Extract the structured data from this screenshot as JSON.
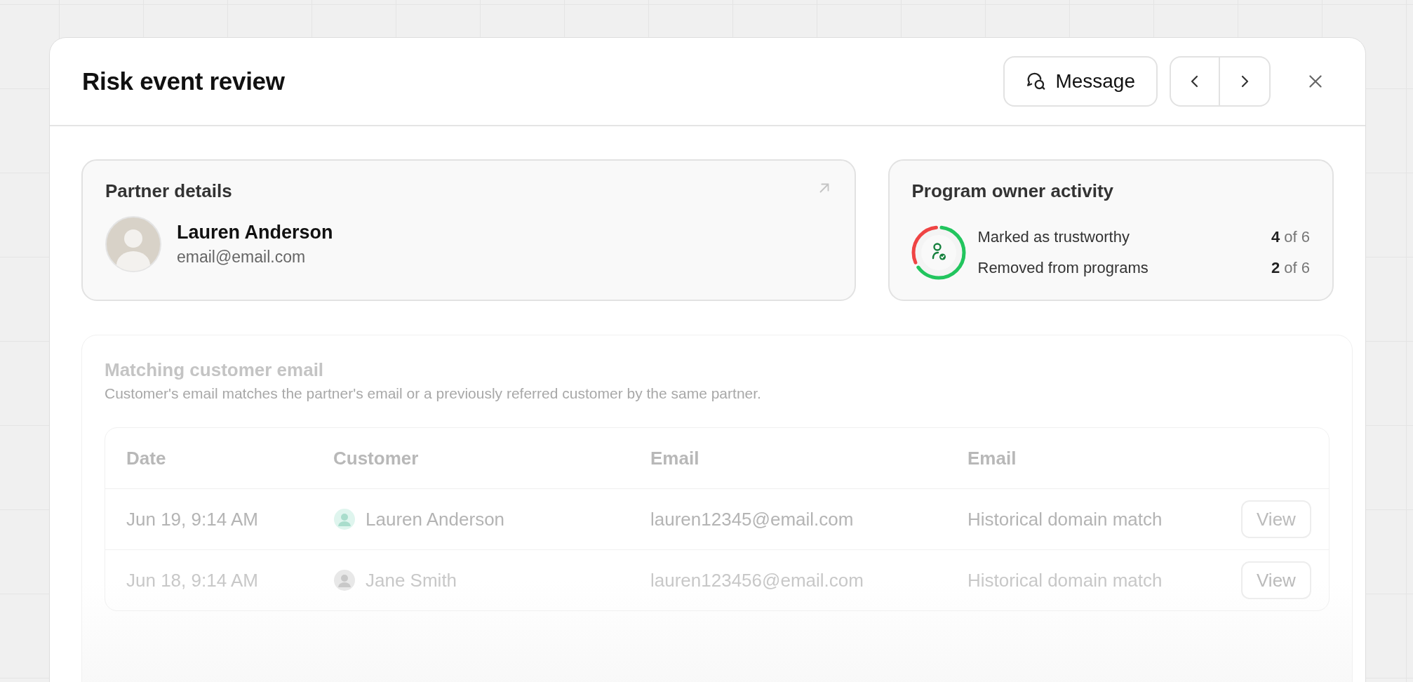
{
  "modal": {
    "title": "Risk event review",
    "message_button": "Message"
  },
  "partner_card": {
    "title": "Partner details",
    "name": "Lauren Anderson",
    "email": "email@email.com"
  },
  "activity_card": {
    "title": "Program owner activity",
    "rows": [
      {
        "label": "Marked as trustworthy",
        "count": "4",
        "total": "of 6",
        "level": 0.667,
        "color": "#22c55e"
      },
      {
        "label": "Removed from programs",
        "count": "2",
        "total": "of 6",
        "level": 0.333,
        "color": "#ef4444"
      }
    ]
  },
  "matching_section": {
    "title": "Matching customer email",
    "description": "Customer's email matches the partner's email or a previously referred customer by the same partner.",
    "table": {
      "columns": [
        "Date",
        "Customer",
        "Email",
        "Email"
      ],
      "rows": [
        {
          "date": "Jun 19, 9:14 AM",
          "customer": "Lauren Anderson",
          "email": "lauren12345@email.com",
          "reason": "Historical domain match",
          "action": "View"
        },
        {
          "date": "Jun 18, 9:14 AM",
          "customer": "Jane Smith",
          "email": "lauren123456@email.com",
          "reason": "Historical domain match",
          "action": "View"
        }
      ]
    }
  }
}
